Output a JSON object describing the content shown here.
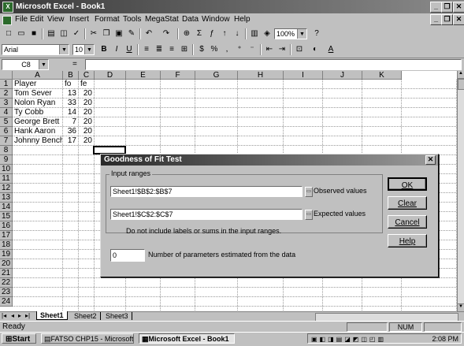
{
  "window": {
    "title": "Microsoft Excel - Book1",
    "icon_text": "X"
  },
  "window_controls": {
    "minimize": "_",
    "restore": "❐",
    "close": "✕"
  },
  "doc_controls": {
    "minimize": "_",
    "restore": "❐",
    "close": "✕"
  },
  "menu": [
    "File",
    "Edit",
    "View",
    "Insert",
    "Format",
    "Tools",
    "MegaStat",
    "Data",
    "Window",
    "Help"
  ],
  "toolbar": {
    "zoom": "100%"
  },
  "format_bar": {
    "font": "Arial",
    "size": "10",
    "bold": "B",
    "italic": "I",
    "underline": "U"
  },
  "formula_bar": {
    "name_box": "C8",
    "equals": "="
  },
  "columns": [
    "A",
    "B",
    "C",
    "D",
    "E",
    "F",
    "G",
    "H",
    "I",
    "J",
    "K"
  ],
  "rows": [
    "1",
    "2",
    "3",
    "4",
    "5",
    "6",
    "7",
    "8",
    "9",
    "10",
    "11",
    "12",
    "13",
    "14",
    "15",
    "16",
    "17",
    "18",
    "19",
    "20",
    "21",
    "22",
    "23",
    "24"
  ],
  "sheet": {
    "headers": {
      "a": "Player",
      "b": "fo",
      "c": "fe"
    },
    "rows": [
      {
        "a": "Tom Sever",
        "b": "13",
        "c": "20"
      },
      {
        "a": "Nolon Ryan",
        "b": "33",
        "c": "20"
      },
      {
        "a": "Ty Cobb",
        "b": "14",
        "c": "20"
      },
      {
        "a": "George Brett",
        "b": "7",
        "c": "20"
      },
      {
        "a": "Hank Aaron",
        "b": "36",
        "c": "20"
      },
      {
        "a": "Johnny Bench",
        "b": "17",
        "c": "20"
      }
    ]
  },
  "tabs": [
    "Sheet1",
    "Sheet2",
    "Sheet3"
  ],
  "status": {
    "left": "Ready",
    "num": "NUM"
  },
  "taskbar": {
    "start": "Start",
    "items": [
      "FATSO CHP15 - Microsoft",
      "Microsoft Excel - Book1"
    ],
    "time": "2:08 PM"
  },
  "dialog": {
    "title": "Goodness of Fit Test",
    "close": "✕",
    "group_label": "Input ranges",
    "observed_range": "Sheet1!$B$2:$B$7",
    "observed_label": "Observed values",
    "expected_range": "Sheet1!$C$2:$C$7",
    "expected_label": "Expected values",
    "note": "Do not include labels or sums in the input ranges.",
    "params_value": "0",
    "params_label": "Number of parameters estimated from the data",
    "ok": "OK",
    "clear": "Clear",
    "cancel": "Cancel",
    "help": "Help"
  }
}
